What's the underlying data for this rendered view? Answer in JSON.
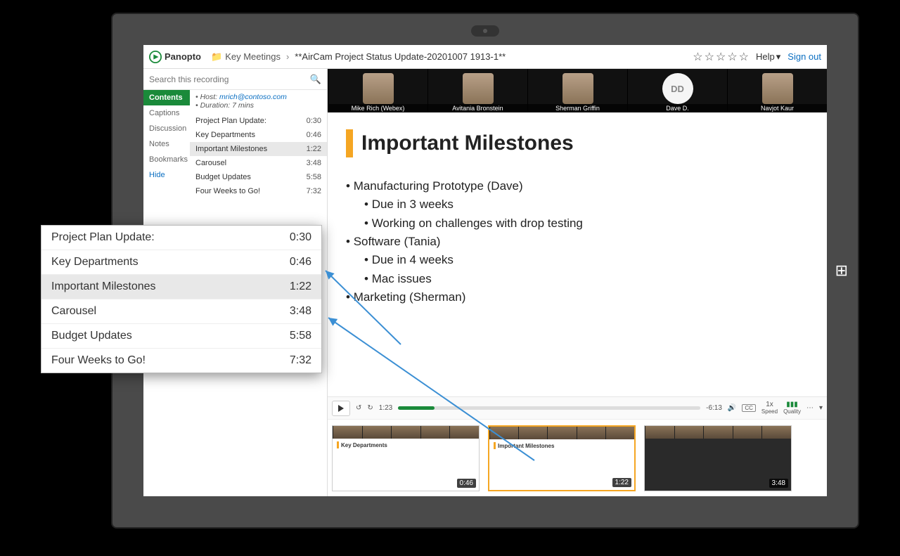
{
  "brand": "Panopto",
  "breadcrumb": {
    "folder": "Key Meetings",
    "title": "**AirCam Project Status Update-20201007 1913-1**"
  },
  "topbar": {
    "help_label": "Help",
    "signout_label": "Sign out"
  },
  "search": {
    "placeholder": "Search this recording"
  },
  "tabs": [
    "Contents",
    "Captions",
    "Discussion",
    "Notes",
    "Bookmarks",
    "Hide"
  ],
  "active_tab": "Contents",
  "meta": {
    "host_label": "Host:",
    "host": "mrich@contoso.com",
    "duration_label": "Duration: 7 mins"
  },
  "chapters": [
    {
      "title": "Project Plan Update:",
      "time": "0:30"
    },
    {
      "title": "Key Departments",
      "time": "0:46"
    },
    {
      "title": "Important Milestones",
      "time": "1:22"
    },
    {
      "title": "Carousel",
      "time": "3:48"
    },
    {
      "title": "Budget Updates",
      "time": "5:58"
    },
    {
      "title": "Four Weeks to Go!",
      "time": "7:32"
    }
  ],
  "active_chapter": 2,
  "participants": [
    {
      "name": "Mike Rich (Webex)"
    },
    {
      "name": "Avitania Bronstein"
    },
    {
      "name": "Sherman Griffin"
    },
    {
      "name": "Dave D.",
      "initials": "DD",
      "placeholder": true
    },
    {
      "name": "Navjot Kaur"
    }
  ],
  "slide": {
    "title": "Important Milestones",
    "bullets": [
      {
        "t": "Manufacturing Prototype (Dave)",
        "sub": [
          "Due in 3 weeks",
          "Working on challenges with drop testing"
        ]
      },
      {
        "t": "Software (Tania)",
        "sub": [
          "Due in 4 weeks",
          "Mac issues"
        ]
      },
      {
        "t": "Marketing (Sherman)",
        "sub": []
      }
    ]
  },
  "controls": {
    "current_time": "1:23",
    "remaining": "-6:13",
    "speed": "1x",
    "speed_label": "Speed",
    "quality_label": "Quality"
  },
  "thumbs": [
    {
      "title": "Key Departments",
      "time": "0:46"
    },
    {
      "title": "Important Milestones",
      "time": "1:22",
      "active": true
    },
    {
      "title": "",
      "time": "3:48"
    }
  ]
}
